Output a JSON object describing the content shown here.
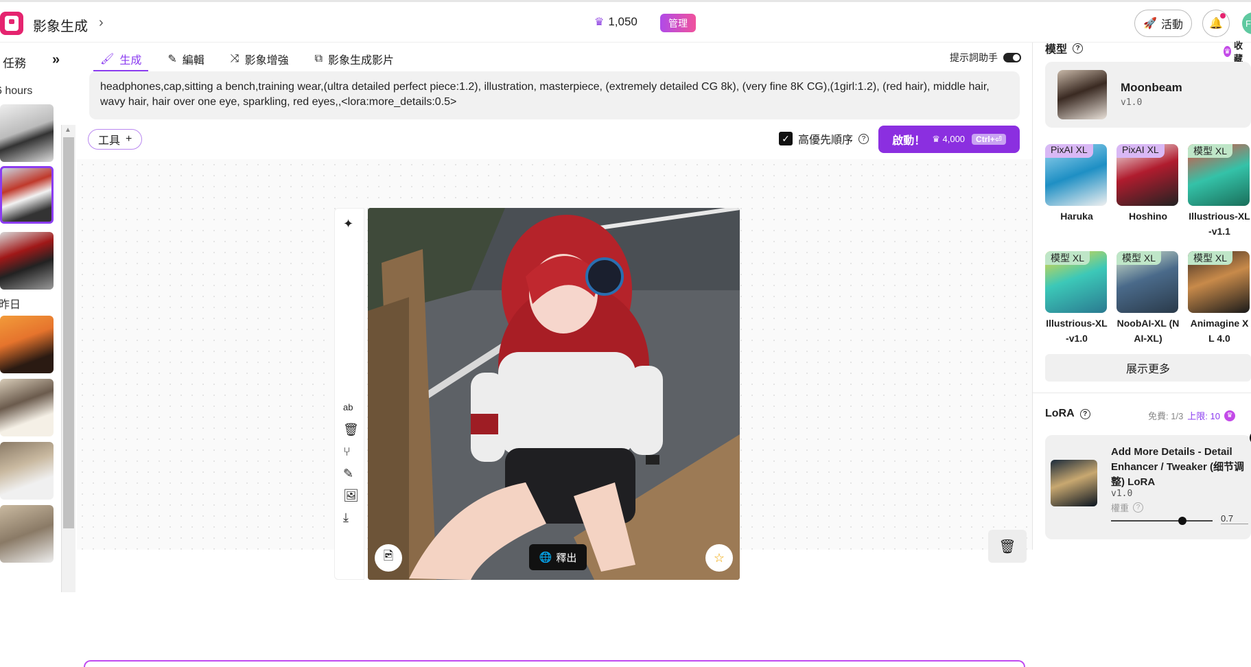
{
  "header": {
    "app_title": "影象生成",
    "credits": "1,050",
    "admin_badge": "管理",
    "activity_label": "活動",
    "avatar_letter": "F"
  },
  "left": {
    "task_title": "任務",
    "group_hours": "6 hours",
    "group_yesterday": "昨日"
  },
  "tabs": [
    {
      "label": "生成",
      "icon": "brush-icon"
    },
    {
      "label": "編輯",
      "icon": "pencil-icon"
    },
    {
      "label": "影象增強",
      "icon": "enhance-icon"
    },
    {
      "label": "影象生成影片",
      "icon": "video-icon"
    }
  ],
  "assist_label": "提示詞助手",
  "prompt_text": "headphones,cap,sitting a bench,training wear,(ultra detailed perfect piece:1.2), illustration, masterpiece, (extremely detailed CG 8k), (very fine 8K CG),(1girl:1.2), (red hair), middle hair, wavy hair, hair over one eye, sparkling, red eyes,,<lora:more_details:0.5>",
  "tools_label": "工具",
  "priority_label": "高優先順序",
  "launch": {
    "label": "啟動！",
    "cost": "4,000",
    "shortcut": "Ctrl+⏎"
  },
  "release_label": "釋出",
  "right": {
    "model_title": "模型",
    "favorites": "收藏",
    "selected_model": {
      "name": "Moonbeam",
      "version": "v1.0"
    },
    "models": [
      {
        "badge": "PixAI XL",
        "name": "Haruka"
      },
      {
        "badge": "PixAI XL",
        "name": "Hoshino"
      },
      {
        "badge": "模型 XL",
        "name": "Illustrious-XL -v1.1"
      },
      {
        "badge": "模型 XL",
        "name": "Illustrious-XL -v1.0"
      },
      {
        "badge": "模型 XL",
        "name": "NoobAI-XL (N AI-XL)"
      },
      {
        "badge": "模型 XL",
        "name": "Animagine X L 4.0"
      }
    ],
    "show_more": "展示更多",
    "lora_title": "LoRA",
    "lora_free": "免費: 1/3",
    "lora_limit": "上限: 10",
    "lora": {
      "name": "Add More Details - Detail Enhancer / Tweaker (细节调整) LoRA",
      "version": "v1.0",
      "weight_label": "權重",
      "weight": 0.7,
      "weight_text": "0.7"
    }
  },
  "colors": {
    "accent": "#8b2fe0",
    "brand": "#e5246f"
  }
}
